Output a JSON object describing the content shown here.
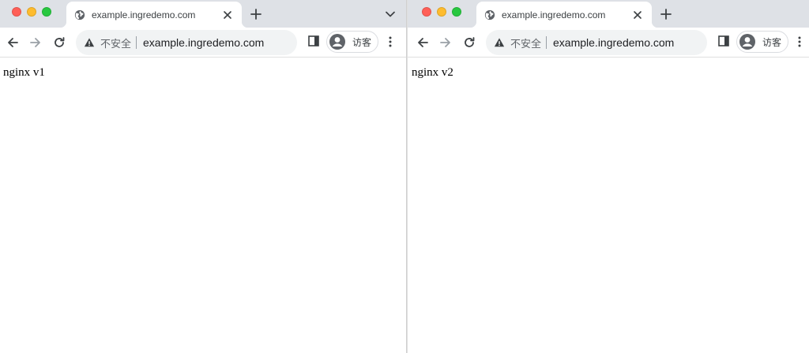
{
  "colors": {
    "close": "#ff5f57",
    "minimize": "#febc2e",
    "maximize": "#28c840",
    "tabstrip": "#dee1e6",
    "omnibox": "#f1f3f4"
  },
  "windows": [
    {
      "tab_title": "example.ingredemo.com",
      "security_label": "不安全",
      "url": "example.ingredemo.com",
      "profile_label": "访客",
      "page_text": "nginx v1"
    },
    {
      "tab_title": "example.ingredemo.com",
      "security_label": "不安全",
      "url": "example.ingredemo.com",
      "profile_label": "访客",
      "page_text": "nginx v2"
    }
  ],
  "icons": {
    "tab_favicon": "globe-icon",
    "new_tab": "plus-icon",
    "tab_search": "chevron-down-icon",
    "back": "arrow-left-icon",
    "forward": "arrow-right-icon",
    "reload": "reload-icon",
    "security": "warning-icon",
    "side_panel": "side-panel-icon",
    "profile": "avatar-icon",
    "menu": "kebab-menu-icon"
  }
}
